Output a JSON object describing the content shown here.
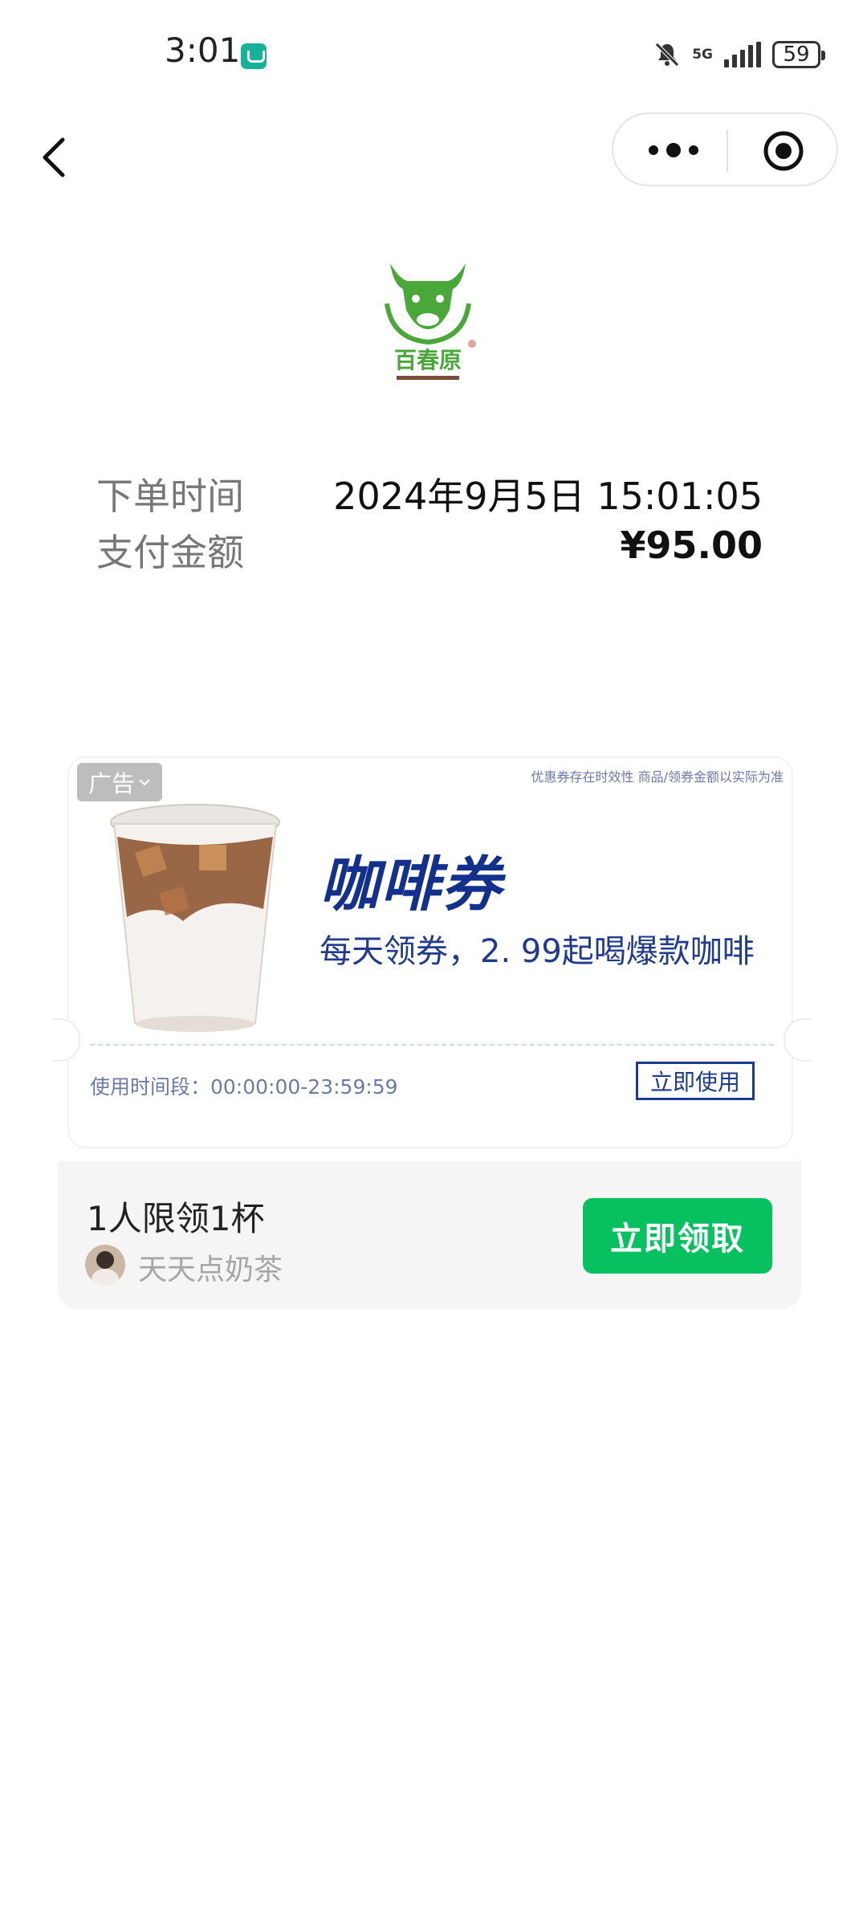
{
  "status_bar": {
    "time": "3:01",
    "network": "5G",
    "battery": "59",
    "icons": [
      "app-notification-icon",
      "bell-muted-icon",
      "signal-icon",
      "battery-icon"
    ]
  },
  "nav": {
    "back_icon": "chevron-left-icon",
    "more_icon": "more-dots-icon",
    "close_icon": "target-circle-icon"
  },
  "brand": {
    "name": "百春原",
    "logo_icon": "bull-head-logo",
    "colors": {
      "green": "#4aa83a"
    }
  },
  "order": {
    "time_label": "下单时间",
    "time_value": "2024年9月5日 15:01:05",
    "amount_label": "支付金额",
    "amount_value": "¥95.00"
  },
  "ad": {
    "badge": "广告",
    "disclaimer": "优惠券存在时效性 商品/领券金额以实际为准",
    "title": "咖啡券",
    "subtitle": "每天领券，2. 99起喝爆款咖啡",
    "use_time": "使用时间段：00:00:00-23:59:59",
    "use_button": "立即使用",
    "colors": {
      "title": "#13308c"
    }
  },
  "claim": {
    "limit": "1人限领1杯",
    "shop_name": "天天点奶茶",
    "button": "立即领取",
    "colors": {
      "button": "#07c160"
    }
  }
}
